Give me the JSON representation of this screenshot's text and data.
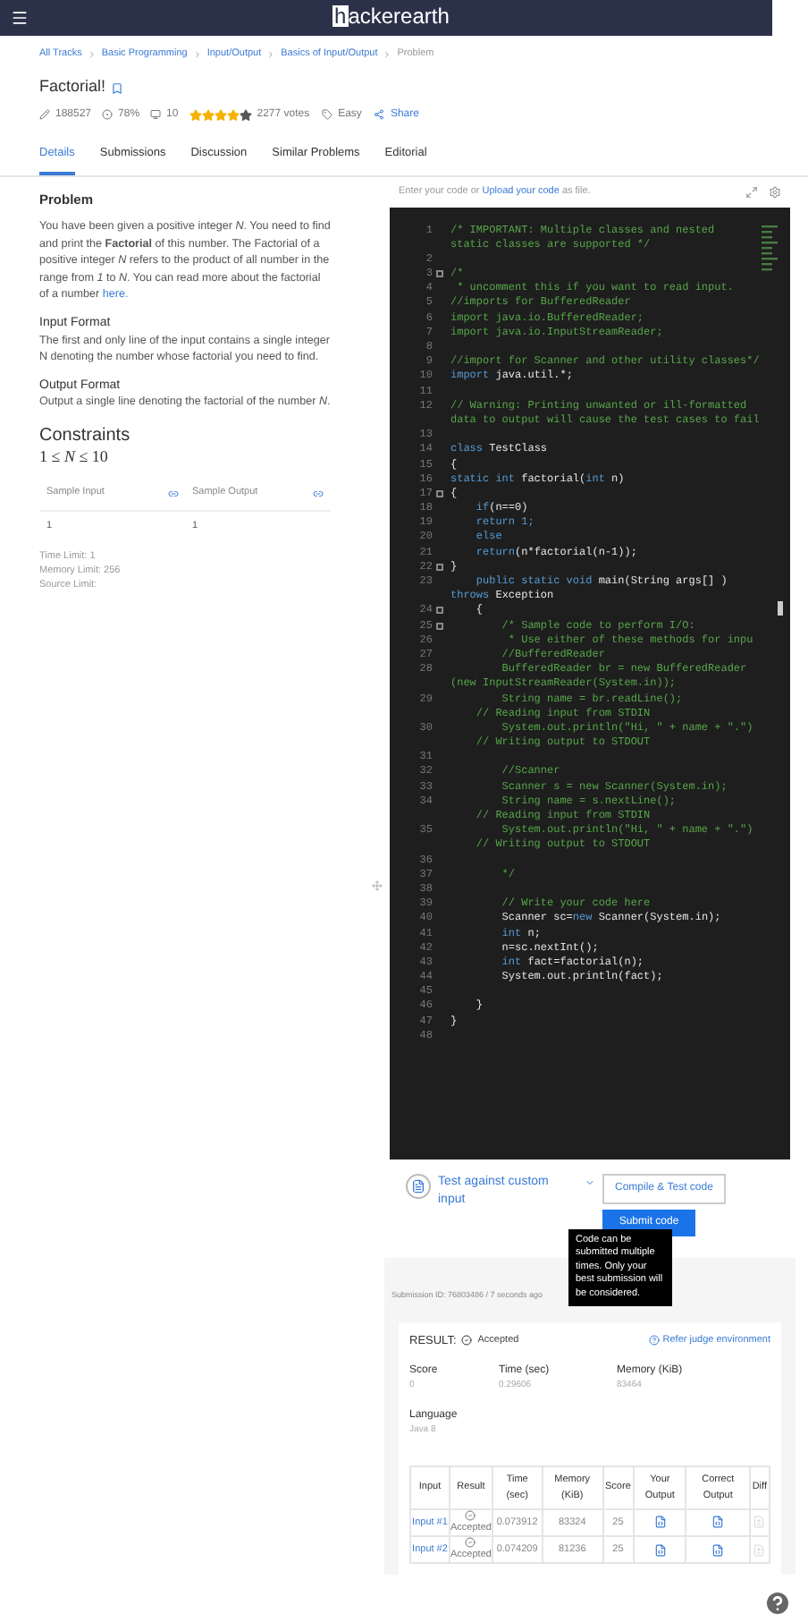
{
  "header": {
    "logo": "hackerearth"
  },
  "breadcrumb": [
    {
      "label": "All Tracks",
      "current": false
    },
    {
      "label": "Basic Programming",
      "current": false
    },
    {
      "label": "Input/Output",
      "current": false
    },
    {
      "label": "Basics of Input/Output",
      "current": false
    },
    {
      "label": "Problem",
      "current": true
    }
  ],
  "problem": {
    "title": "Factorial!",
    "bookmarked": false,
    "meta": {
      "solved": "188527",
      "success": "78%",
      "points": "10",
      "stars": 4,
      "votes": "2277 votes",
      "difficulty": "Easy",
      "share": "Share"
    }
  },
  "tabs": [
    {
      "label": "Details",
      "selected": true
    },
    {
      "label": "Submissions",
      "selected": false
    },
    {
      "label": "Discussion",
      "selected": false
    },
    {
      "label": "Similar Problems",
      "selected": false
    },
    {
      "label": "Editorial",
      "selected": false
    }
  ],
  "details": {
    "heading": "Problem",
    "paragraph": "You have been given a positive integer *N*. You need to find and print the **Factorial** of this number. The Factorial of a positive integer *N* refers to the product of all number in the range from *1* to *N*. You can read more about the factorial of a number",
    "paragraph_link": "here.",
    "sections": [
      {
        "heading": "Input Format",
        "text": "The first and only line of the input contains a single integer N denoting the number whose factorial you need to find."
      },
      {
        "heading": "Output Format",
        "text": "Output a single line denoting the factorial of the number *N*."
      }
    ],
    "constraints_heading": "Constraints",
    "constraints": "1 ≤ *N* ≤ 10",
    "samples": [
      {
        "label": "Sample Input",
        "value": "1"
      },
      {
        "label": "Sample Output",
        "value": "1"
      }
    ],
    "limits": [
      "Time Limit: 1",
      "Memory Limit: 256",
      "Source Limit:"
    ]
  },
  "editor": {
    "hint": "Enter your code or",
    "hint_link": "Upload your code",
    "hint_end": "as file.",
    "lines": [
      {
        "number": "1",
        "tokens": [
          {
            "kind": "comment",
            "s": "/* IMPORTANT: Multiple classes and nested"
          }
        ],
        "wrap": [
          {
            "kind": "comment",
            "s": "static classes are supported */"
          }
        ]
      },
      {
        "number": "2"
      },
      {
        "number": "3",
        "fold": true,
        "tokens": [
          {
            "kind": "comment",
            "s": "/*"
          }
        ]
      },
      {
        "number": "4",
        "tokens": [
          {
            "kind": "comment",
            "s": " * uncomment this if you want to read input."
          }
        ]
      },
      {
        "number": "5",
        "tokens": [
          {
            "kind": "comment",
            "s": "//imports for BufferedReader"
          }
        ]
      },
      {
        "number": "6",
        "tokens": [
          {
            "kind": "comment",
            "s": "import java.io.BufferedReader;"
          }
        ]
      },
      {
        "number": "7",
        "tokens": [
          {
            "kind": "comment",
            "s": "import java.io.InputStreamReader;"
          }
        ]
      },
      {
        "number": "8"
      },
      {
        "number": "9",
        "tokens": [
          {
            "kind": "comment",
            "s": "//import for Scanner and other utility classes*/"
          }
        ]
      },
      {
        "number": "10",
        "tokens": [
          {
            "kind": "keyword",
            "s": "import "
          },
          {
            "kind": "plain",
            "s": "java.util.*;"
          }
        ]
      },
      {
        "number": "11"
      },
      {
        "number": "12",
        "tokens": [
          {
            "kind": "comment",
            "s": "// Warning: Printing unwanted or ill-formatted"
          }
        ],
        "wrap": [
          {
            "kind": "comment",
            "s": "data to output will cause the test cases to fail"
          }
        ]
      },
      {
        "number": "13"
      },
      {
        "number": "14",
        "tokens": [
          {
            "kind": "keyword",
            "s": "class "
          },
          {
            "kind": "plain",
            "s": "TestClass"
          }
        ]
      },
      {
        "number": "15",
        "tokens": [
          {
            "kind": "plain",
            "s": "{"
          }
        ]
      },
      {
        "number": "16",
        "tokens": [
          {
            "kind": "keyword",
            "s": "static int "
          },
          {
            "kind": "plain",
            "s": "factorial("
          },
          {
            "kind": "keyword",
            "s": "int "
          },
          {
            "kind": "plain",
            "s": "n)"
          }
        ]
      },
      {
        "number": "17",
        "fold": true,
        "tokens": [
          {
            "kind": "plain",
            "s": "{"
          }
        ]
      },
      {
        "number": "18",
        "tokens": [
          {
            "kind": "keyword",
            "s": "    if"
          },
          {
            "kind": "plain",
            "s": "(n==0)"
          }
        ]
      },
      {
        "number": "19",
        "tokens": [
          {
            "kind": "keyword",
            "s": "    return 1;"
          }
        ]
      },
      {
        "number": "20",
        "tokens": [
          {
            "kind": "keyword",
            "s": "    else"
          }
        ]
      },
      {
        "number": "21",
        "tokens": [
          {
            "kind": "keyword",
            "s": "    return"
          },
          {
            "kind": "plain",
            "s": "(n*factorial(n-1));"
          }
        ]
      },
      {
        "number": "22",
        "fold": true,
        "tokens": [
          {
            "kind": "plain",
            "s": "}"
          }
        ]
      },
      {
        "number": "23",
        "tokens": [
          {
            "kind": "keyword",
            "s": "    public static void "
          },
          {
            "kind": "plain",
            "s": "main(String args[] )"
          }
        ],
        "wrap": [
          {
            "kind": "keyword",
            "s": "throws "
          },
          {
            "kind": "plain",
            "s": "Exception"
          }
        ]
      },
      {
        "number": "24",
        "fold": true,
        "tokens": [
          {
            "kind": "plain",
            "s": "    {"
          }
        ]
      },
      {
        "number": "25",
        "fold": true,
        "tokens": [
          {
            "kind": "comment",
            "s": "        /* Sample code to perform I/O:"
          }
        ]
      },
      {
        "number": "26",
        "tokens": [
          {
            "kind": "comment",
            "s": "         * Use either of these methods for inpu"
          }
        ]
      },
      {
        "number": "27",
        "tokens": [
          {
            "kind": "comment",
            "s": "        //BufferedReader"
          }
        ]
      },
      {
        "number": "28",
        "tokens": [
          {
            "kind": "comment",
            "s": "        BufferedReader br = new BufferedReader"
          }
        ],
        "wrap": [
          {
            "kind": "comment",
            "s": "(new InputStreamReader(System.in));"
          }
        ]
      },
      {
        "number": "29",
        "tokens": [
          {
            "kind": "comment",
            "s": "        String name = br.readLine();"
          }
        ],
        "wrap": [
          {
            "kind": "comment",
            "s": "    // Reading input from STDIN"
          }
        ]
      },
      {
        "number": "30",
        "tokens": [
          {
            "kind": "comment",
            "s": "        System.out.println(\"Hi, \" + name + \".\")"
          }
        ],
        "wrap": [
          {
            "kind": "comment",
            "s": "    // Writing output to STDOUT"
          }
        ]
      },
      {
        "number": "31"
      },
      {
        "number": "32",
        "tokens": [
          {
            "kind": "comment",
            "s": "        //Scanner"
          }
        ]
      },
      {
        "number": "33",
        "tokens": [
          {
            "kind": "comment",
            "s": "        Scanner s = new Scanner(System.in);"
          }
        ]
      },
      {
        "number": "34",
        "tokens": [
          {
            "kind": "comment",
            "s": "        String name = s.nextLine();"
          }
        ],
        "wrap": [
          {
            "kind": "comment",
            "s": "    // Reading input from STDIN"
          }
        ]
      },
      {
        "number": "35",
        "tokens": [
          {
            "kind": "comment",
            "s": "        System.out.println(\"Hi, \" + name + \".\")"
          }
        ],
        "wrap": [
          {
            "kind": "comment",
            "s": "    // Writing output to STDOUT"
          }
        ]
      },
      {
        "number": "36"
      },
      {
        "number": "37",
        "tokens": [
          {
            "kind": "comment",
            "s": "        */"
          }
        ]
      },
      {
        "number": "38"
      },
      {
        "number": "39",
        "tokens": [
          {
            "kind": "comment",
            "s": "        // Write your code here"
          }
        ]
      },
      {
        "number": "40",
        "tokens": [
          {
            "kind": "plain",
            "s": "        Scanner sc="
          },
          {
            "kind": "keyword",
            "s": "new "
          },
          {
            "kind": "plain",
            "s": "Scanner(System.in);"
          }
        ]
      },
      {
        "number": "41",
        "tokens": [
          {
            "kind": "keyword",
            "s": "        int "
          },
          {
            "kind": "plain",
            "s": "n;"
          }
        ]
      },
      {
        "number": "42",
        "tokens": [
          {
            "kind": "plain",
            "s": "        n=sc.nextInt();"
          }
        ]
      },
      {
        "number": "43",
        "tokens": [
          {
            "kind": "keyword",
            "s": "        int "
          },
          {
            "kind": "plain",
            "s": "fact=factorial(n);"
          }
        ]
      },
      {
        "number": "44",
        "tokens": [
          {
            "kind": "plain",
            "s": "        System.out.println(fact);"
          }
        ]
      },
      {
        "number": "45"
      },
      {
        "number": "46",
        "tokens": [
          {
            "kind": "plain",
            "s": "    }"
          }
        ]
      },
      {
        "number": "47",
        "tokens": [
          {
            "kind": "plain",
            "s": "}"
          }
        ]
      },
      {
        "number": "48"
      }
    ]
  },
  "actions": {
    "custom_input": "Test against custom input",
    "compile": "Compile & Test code",
    "submit": "Submit code",
    "tooltip": "Code can be submitted multiple times. Only your best submission will be considered."
  },
  "submission": {
    "id": "Submission ID: 76803486 / 7 seconds ago",
    "result_label": "RESULT:",
    "result": "Accepted",
    "judge_link": "Refer judge environment",
    "stats": [
      {
        "label": "Score",
        "value": "0"
      },
      {
        "label": "Time (sec)",
        "value": "0.29606"
      },
      {
        "label": "Memory (KiB)",
        "value": "83464"
      }
    ],
    "language_label": "Language",
    "language": "Java 8",
    "columns": [
      "Input",
      "Result",
      "Time (sec)",
      "Memory (KiB)",
      "Score",
      "Your Output",
      "Correct Output",
      "Diff"
    ],
    "rows": [
      {
        "input": "Input #1",
        "result": "Accepted",
        "time": "0.073912",
        "memory": "83324",
        "score": "25"
      },
      {
        "input": "Input #2",
        "result": "Accepted",
        "time": "0.074209",
        "memory": "81236",
        "score": "25"
      }
    ]
  }
}
